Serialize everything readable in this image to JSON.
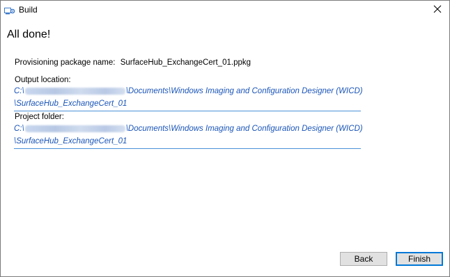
{
  "window": {
    "title": "Build",
    "icon": "build-gear-icon"
  },
  "heading": "All done!",
  "package": {
    "label": "Provisioning package name:",
    "value": "SurfaceHub_ExchangeCert_01.ppkg"
  },
  "output_location": {
    "label": "Output location:",
    "path_prefix": "C:\\",
    "path_line1_rest": "\\Documents\\Windows Imaging and Configuration Designer (WICD)",
    "path_line2": "\\SurfaceHub_ExchangeCert_01"
  },
  "project_folder": {
    "label": "Project folder:",
    "path_prefix": "C:\\",
    "path_line1_rest": "\\Documents\\Windows Imaging and Configuration Designer (WICD)",
    "path_line2": "\\SurfaceHub_ExchangeCert_01"
  },
  "buttons": {
    "back": "Back",
    "finish": "Finish"
  },
  "colors": {
    "link": "#1a55b8",
    "accent": "#0078d7"
  }
}
